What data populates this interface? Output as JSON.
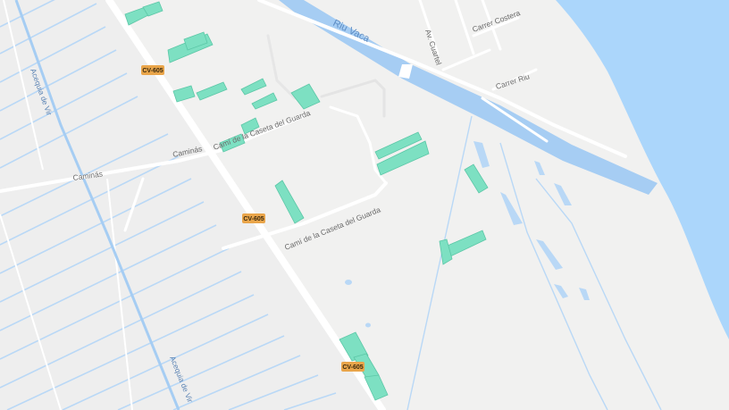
{
  "map": {
    "colors": {
      "land": "#f1f1f0",
      "sea": "#abd6fb",
      "canal": "#b9d8f6",
      "river": "#a6cdf3",
      "road": "#ffffff",
      "building": "#7de0c2",
      "shield": "#e9a54a"
    },
    "labels": {
      "river": "Riu Vaca",
      "street_cuartel": "Av. Cuartel",
      "street_costera": "Carrer Costera",
      "street_riu": "Carrer Riu",
      "caminas_1": "Caminás",
      "caminas_2": "Caminás",
      "cami_guarda_1": "Camí de la Caseta del Guarda",
      "cami_guarda_2": "Camí de la Caseta del Guarda",
      "acequia_1": "Acequia de Vir",
      "acequia_2": "Acequia de Vir"
    },
    "road_shields": [
      {
        "name": "cv605-top",
        "text": "CV-605"
      },
      {
        "name": "cv605-middle",
        "text": "CV-605"
      },
      {
        "name": "cv605-bottom",
        "text": "CV-605"
      }
    ]
  }
}
